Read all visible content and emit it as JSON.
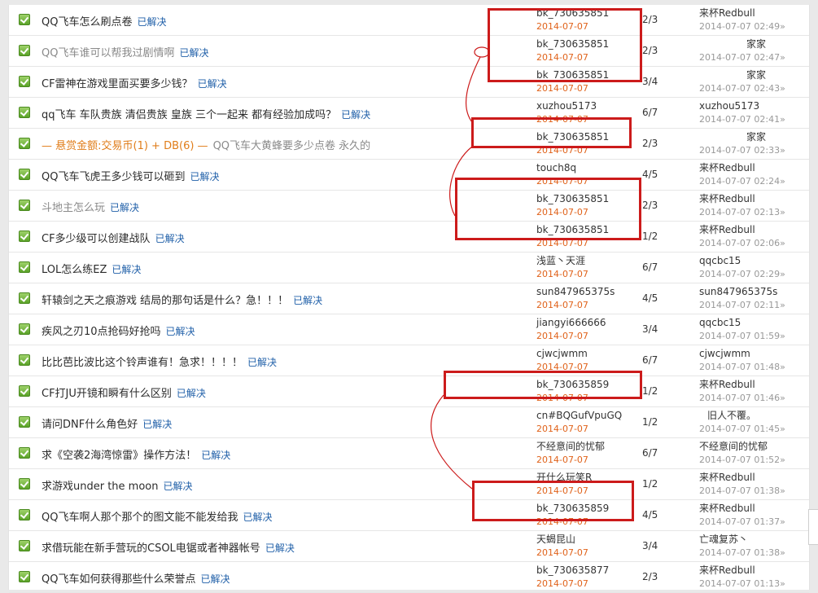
{
  "labels": {
    "solved": "已解决"
  },
  "rows": [
    {
      "title": "QQ飞车怎么刷点卷",
      "author": "bk_730635851",
      "date": "2014-07-07",
      "counts": "2/3",
      "last_user": "来杯Redbull",
      "last_date": "2014-07-07 02:49»"
    },
    {
      "title": "QQ飞车谁可以帮我过剧情啊",
      "author": "bk_730635851",
      "date": "2014-07-07",
      "counts": "2/3",
      "last_user": "家家",
      "last_date": "2014-07-07 02:47»"
    },
    {
      "title": "CF雷神在游戏里面买要多少钱？",
      "author": "bk_730635851",
      "date": "2014-07-07",
      "counts": "3/4",
      "last_user": "家家",
      "last_date": "2014-07-07 02:43»"
    },
    {
      "title": "qq飞车 车队贵族 清侣贵族 皇族 三个一起来 都有经验加成吗？",
      "author": "xuzhou5173",
      "date": "2014-07-07",
      "counts": "6/7",
      "last_user": "xuzhou5173",
      "last_date": "2014-07-07 02:41»"
    },
    {
      "bounty": "— 悬赏金额:交易币(1) + DB(6) —",
      "title": "QQ飞车大黄蜂要多少点卷 永久的",
      "author": "bk_730635851",
      "date": "2014-07-07",
      "counts": "2/3",
      "last_user": "家家",
      "last_date": "2014-07-07 02:33»"
    },
    {
      "title": "QQ飞车飞虎王多少钱可以砸到",
      "author": "touch8q",
      "date": "2014-07-07",
      "counts": "4/5",
      "last_user": "来杯Redbull",
      "last_date": "2014-07-07 02:24»"
    },
    {
      "title": "斗地主怎么玩",
      "author": "bk_730635851",
      "date": "2014-07-07",
      "counts": "2/3",
      "last_user": "来杯Redbull",
      "last_date": "2014-07-07 02:13»"
    },
    {
      "title": "CF多少级可以创建战队",
      "author": "bk_730635851",
      "date": "2014-07-07",
      "counts": "1/2",
      "last_user": "来杯Redbull",
      "last_date": "2014-07-07 02:06»"
    },
    {
      "title": "LOL怎么练EZ",
      "author": "浅蓝丶天涯",
      "date": "2014-07-07",
      "counts": "6/7",
      "last_user": "qqcbc15",
      "last_date": "2014-07-07 02:29»"
    },
    {
      "title": "轩辕剑之天之痕游戏 结局的那句话是什么？急！！！",
      "author": "sun847965375s",
      "date": "2014-07-07",
      "counts": "4/5",
      "last_user": "sun847965375s",
      "last_date": "2014-07-07 02:11»"
    },
    {
      "title": "疾风之刃10点抢码好抢吗",
      "author": "jiangyi666666",
      "date": "2014-07-07",
      "counts": "3/4",
      "last_user": "qqcbc15",
      "last_date": "2014-07-07 01:59»"
    },
    {
      "title": "比比芭比波比这个铃声谁有！急求！！！！",
      "author": "cjwcjwmm",
      "date": "2014-07-07",
      "counts": "6/7",
      "last_user": "cjwcjwmm",
      "last_date": "2014-07-07 01:48»"
    },
    {
      "title": "CF打JU开镜和瞬有什么区别",
      "author": "bk_730635859",
      "date": "2014-07-07",
      "counts": "1/2",
      "last_user": "来杯Redbull",
      "last_date": "2014-07-07 01:46»"
    },
    {
      "title": "请问DNF什么角色好",
      "author": "cn#BQGufVpuGQ",
      "date": "2014-07-07",
      "counts": "1/2",
      "last_user": "旧人不覆。",
      "last_date": "2014-07-07 01:45»"
    },
    {
      "title": "求《空袭2海湾惊雷》操作方法！",
      "author": "不经意间的忧郁",
      "date": "2014-07-07",
      "counts": "6/7",
      "last_user": "不经意间的忧郁",
      "last_date": "2014-07-07 01:52»"
    },
    {
      "title": "求游戏under the moon",
      "author": "开什么玩笑R",
      "date": "2014-07-07",
      "counts": "1/2",
      "last_user": "来杯Redbull",
      "last_date": "2014-07-07 01:38»"
    },
    {
      "title": "QQ飞车啊人那个那个的图文能不能发给我",
      "author": "bk_730635859",
      "date": "2014-07-07",
      "counts": "4/5",
      "last_user": "来杯Redbull",
      "last_date": "2014-07-07 01:37»"
    },
    {
      "title": "求借玩能在新手营玩的CSOL电锯或者神器帐号",
      "author": "天蝎昆山",
      "date": "2014-07-07",
      "counts": "3/4",
      "last_user": "亡魂复苏丶",
      "last_date": "2014-07-07 01:38»"
    },
    {
      "title": "QQ飞车如何获得那些什么荣誉点",
      "author": "bk_730635877",
      "date": "2014-07-07",
      "counts": "2/3",
      "last_user": "来杯Redbull",
      "last_date": "2014-07-07 01:13»"
    }
  ]
}
